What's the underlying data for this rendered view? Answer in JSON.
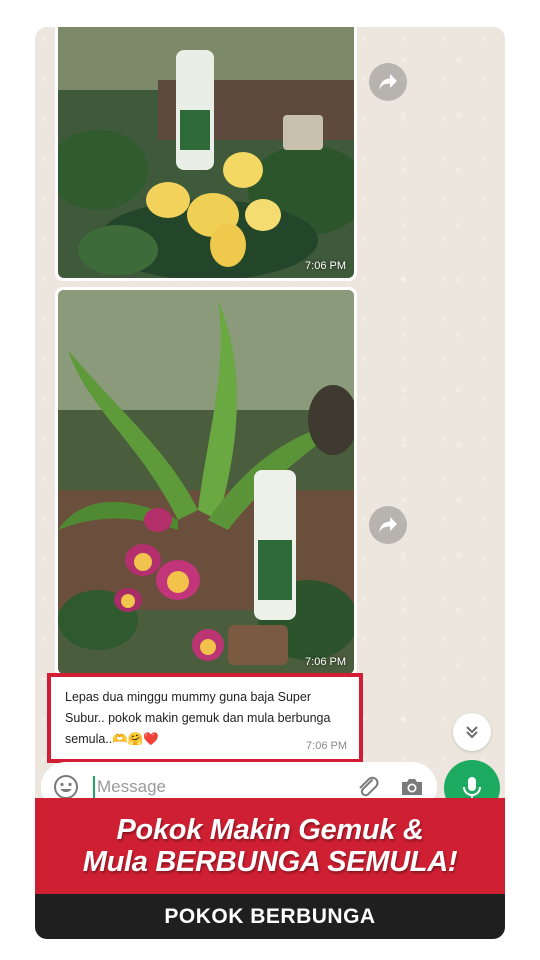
{
  "messages": [
    {
      "type": "image",
      "time": "7:06 PM"
    },
    {
      "type": "image",
      "time": "7:06 PM"
    },
    {
      "type": "text",
      "text": "Lepas dua minggu mummy guna baja Super Subur.. pokok makin gemuk dan mula berbunga semula..🫶🤗❤️",
      "time": "7:06 PM"
    }
  ],
  "composer": {
    "placeholder": "Message",
    "icons": [
      "emoji-icon",
      "attach-icon",
      "camera-icon",
      "mic-icon"
    ]
  },
  "banner": {
    "line1": "Pokok Makin Gemuk &",
    "line2": "Mula BERBUNGA SEMULA!"
  },
  "footer": {
    "label": "POKOK BERBUNGA"
  },
  "colors": {
    "accent_green": "#1daa61",
    "banner_red": "#cf1f32",
    "highlight_border": "#d21d34",
    "footer_dark": "#1f1f1f",
    "chat_bg": "#ece6de"
  }
}
